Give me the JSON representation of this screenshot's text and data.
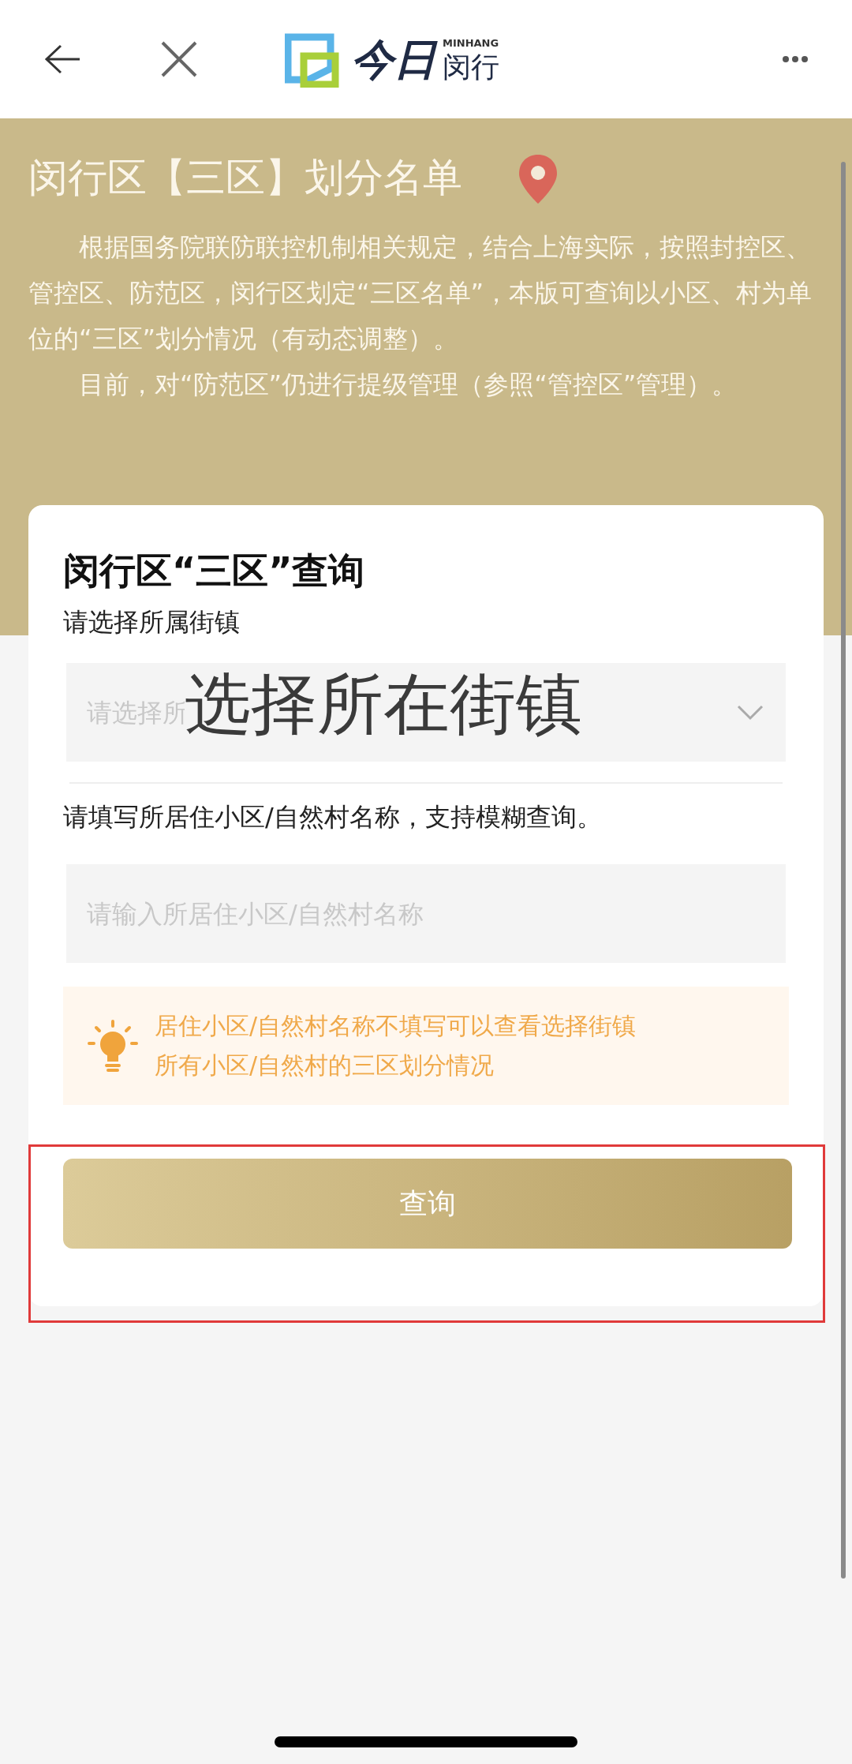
{
  "nav": {
    "logo_script": "今日",
    "logo_latin": "MINHANG",
    "logo_name": "闵行"
  },
  "banner": {
    "title": "闵行区【三区】划分名单",
    "paragraphs": [
      "根据国务院联防联控机制相关规定，结合上海实际，按照封控区、管控区、防范区，闵行区划定“三区名单”，本版可查询以小区、村为单位的“三区”划分情况（有动态调整）。",
      "目前，对“防范区”仍进行提级管理（参照“管控区”管理）。"
    ]
  },
  "form": {
    "title": "闵行区“三区”查询",
    "street_label": "请选择所属街镇",
    "street_select": {
      "placeholder": "请选择所"
    },
    "overlay_text": "选择所在街镇",
    "community_label": "请填写所居住小区/自然村名称，支持模糊查询。",
    "community_input": {
      "placeholder": "请输入所居住小区/自然村名称"
    },
    "tip": [
      "居住小区/自然村名称不填写可以查看选择街镇",
      "所有小区/自然村的三区划分情况"
    ],
    "submit": "查询"
  }
}
